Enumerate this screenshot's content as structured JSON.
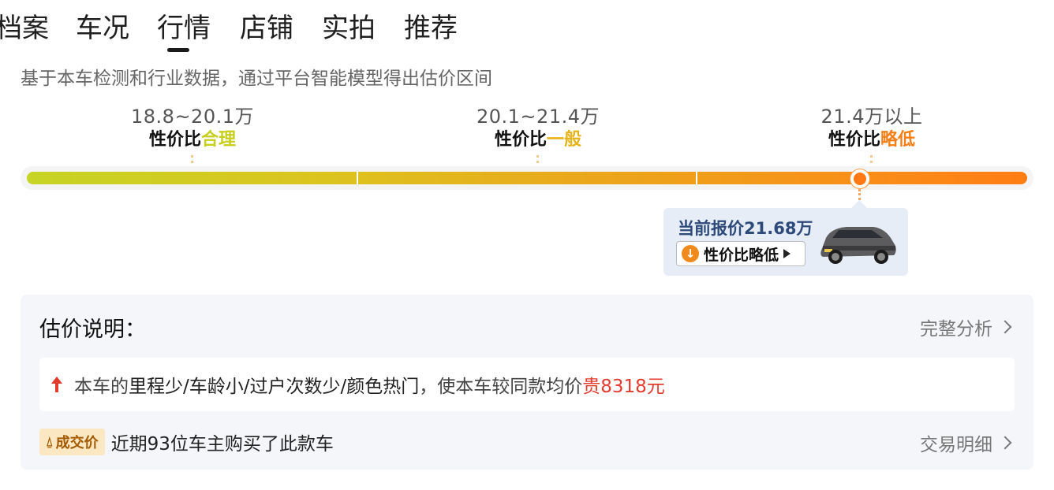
{
  "tabs": [
    "档案",
    "车况",
    "行情",
    "店铺",
    "实拍",
    "推荐"
  ],
  "active_tab": "行情",
  "subtitle": "基于本车检测和行业数据，通过平台智能模型得出估价区间",
  "ranges": [
    {
      "price": "18.8~20.1万",
      "verdict_prefix": "性价比",
      "verdict": "合理",
      "color": "#c7cf1e"
    },
    {
      "price": "20.1~21.4万",
      "verdict_prefix": "性价比",
      "verdict": "一般",
      "color": "#e6b41a"
    },
    {
      "price": "21.4万以上",
      "verdict_prefix": "性价比",
      "verdict": "略低",
      "color": "#f47f16"
    }
  ],
  "current_price_fraction": 0.83,
  "popup": {
    "quote": "当前报价21.68万",
    "pill_label": "性价比略低",
    "icons": {
      "down": "arrow-down-circle-icon",
      "play": "play-triangle-icon"
    }
  },
  "card": {
    "title": "估价说明：",
    "full_analysis": "完整分析",
    "notice": {
      "prefix": "本车的",
      "highlights": "里程少/车龄小/过户次数少/颜色热门",
      "middle": "，使本车较同款均价",
      "diff": "贵8318元",
      "icon": "arrow-up-icon",
      "icon_color": "#e33b2e"
    },
    "deal": {
      "badge": "成交价",
      "text": "近期93位车主购买了此款车",
      "detail_link": "交易明细"
    }
  }
}
